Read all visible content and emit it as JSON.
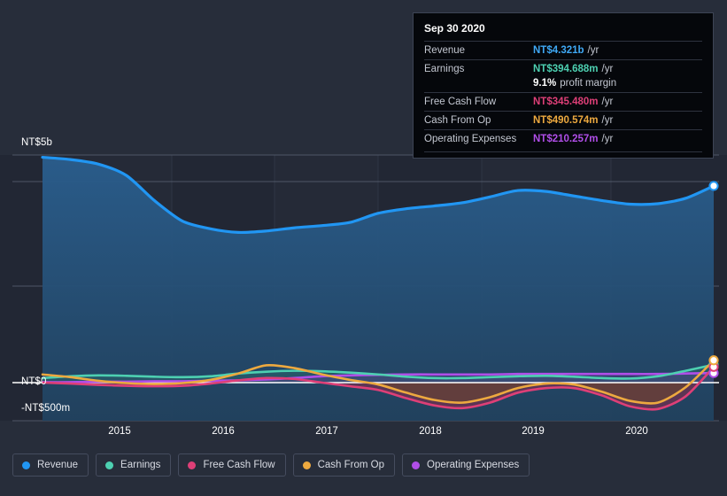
{
  "chart_data": {
    "type": "area",
    "title": "",
    "xlabel": "",
    "ylabel": "",
    "grid": true,
    "legend_position": "bottom",
    "currency_prefix": "NT$",
    "xlim": [
      "2014.5",
      "2020.8"
    ],
    "ylim": [
      -500000000,
      5000000000
    ],
    "y_ticks": [
      {
        "label": "NT$5b",
        "value": 5000000000
      },
      {
        "label": "NT$0",
        "value": 0
      },
      {
        "label": "-NT$500m",
        "value": -500000000
      }
    ],
    "x_ticks": [
      "2015",
      "2016",
      "2017",
      "2018",
      "2019",
      "2020"
    ],
    "series": [
      {
        "name": "Revenue",
        "color": "#2196f3",
        "values": [
          4.95,
          4.9,
          4.8,
          4.55,
          4.0,
          3.55,
          3.38,
          3.3,
          3.33,
          3.4,
          3.45,
          3.52,
          3.72,
          3.82,
          3.88,
          3.95,
          4.08,
          4.22,
          4.2,
          4.1,
          4.0,
          3.92,
          3.93,
          4.05,
          4.321
        ],
        "unit": "b"
      },
      {
        "name": "Earnings",
        "color": "#4dd0b1",
        "values": [
          0.1,
          0.14,
          0.16,
          0.15,
          0.13,
          0.12,
          0.14,
          0.2,
          0.24,
          0.26,
          0.25,
          0.22,
          0.18,
          0.13,
          0.1,
          0.1,
          0.12,
          0.14,
          0.15,
          0.13,
          0.1,
          0.09,
          0.14,
          0.26,
          0.394688
        ],
        "unit": "b"
      },
      {
        "name": "Free Cash Flow",
        "color": "#de3f77",
        "values": [
          0.0,
          -0.02,
          -0.05,
          -0.07,
          -0.08,
          -0.07,
          -0.02,
          0.05,
          0.1,
          0.08,
          0.0,
          -0.08,
          -0.16,
          -0.34,
          -0.5,
          -0.56,
          -0.44,
          -0.22,
          -0.12,
          -0.12,
          -0.28,
          -0.52,
          -0.58,
          -0.3,
          0.34548
        ],
        "unit": "b"
      },
      {
        "name": "Cash From Op",
        "color": "#eda93f",
        "values": [
          0.18,
          0.12,
          0.04,
          -0.01,
          -0.03,
          -0.01,
          0.06,
          0.2,
          0.38,
          0.32,
          0.18,
          0.06,
          -0.04,
          -0.22,
          -0.38,
          -0.44,
          -0.32,
          -0.12,
          -0.02,
          -0.04,
          -0.2,
          -0.4,
          -0.44,
          -0.1,
          0.490574
        ],
        "unit": "b"
      },
      {
        "name": "Operating Expenses",
        "color": "#b04ee8",
        "values": [
          0.01,
          0.01,
          0.02,
          0.02,
          0.03,
          0.03,
          0.04,
          0.05,
          0.07,
          0.1,
          0.14,
          0.16,
          0.17,
          0.18,
          0.18,
          0.18,
          0.18,
          0.19,
          0.19,
          0.19,
          0.19,
          0.19,
          0.19,
          0.2,
          0.210257
        ],
        "unit": "b"
      }
    ]
  },
  "tooltip": {
    "date": "Sep 30 2020",
    "rows": [
      {
        "label": "Revenue",
        "value": "NT$4.321b",
        "unit": "/yr",
        "color": "#3fa9f5"
      },
      {
        "label": "Earnings",
        "value": "NT$394.688m",
        "unit": "/yr",
        "color": "#4dd0b1"
      },
      {
        "label": "",
        "value": "9.1%",
        "unit": "profit margin",
        "color": "#ffffff"
      },
      {
        "label": "Free Cash Flow",
        "value": "NT$345.480m",
        "unit": "/yr",
        "color": "#de3f77"
      },
      {
        "label": "Cash From Op",
        "value": "NT$490.574m",
        "unit": "/yr",
        "color": "#eda93f"
      },
      {
        "label": "Operating Expenses",
        "value": "NT$210.257m",
        "unit": "/yr",
        "color": "#b04ee8"
      }
    ]
  },
  "legend": {
    "items": [
      {
        "label": "Revenue",
        "color": "#2196f3"
      },
      {
        "label": "Earnings",
        "color": "#4dd0b1"
      },
      {
        "label": "Free Cash Flow",
        "color": "#de3f77"
      },
      {
        "label": "Cash From Op",
        "color": "#eda93f"
      },
      {
        "label": "Operating Expenses",
        "color": "#b04ee8"
      }
    ]
  },
  "axis": {
    "y_labels": [
      "NT$5b",
      "NT$0",
      "-NT$500m"
    ],
    "x_labels": [
      "2015",
      "2016",
      "2017",
      "2018",
      "2019",
      "2020"
    ]
  }
}
